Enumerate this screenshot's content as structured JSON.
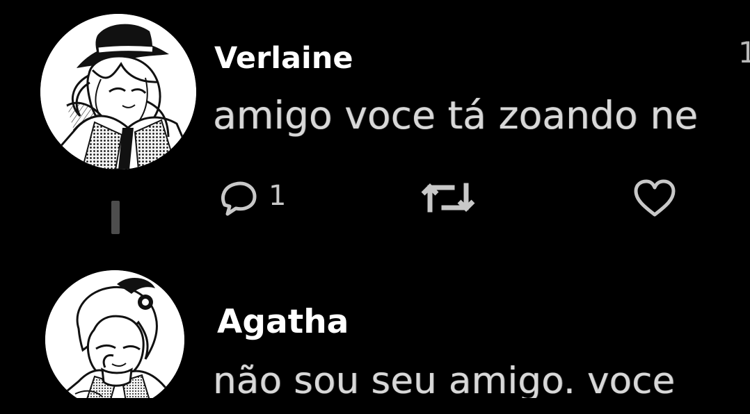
{
  "window": {
    "background_color": "#000000"
  },
  "posts": [
    {
      "author": "Verlaine",
      "message": "amigo voce tá zoando ne",
      "avatar_icon": "verlaine-avatar-icon"
    },
    {
      "author": "Agatha",
      "message": "não sou seu amigo. voce",
      "avatar_icon": "agatha-avatar-icon"
    }
  ],
  "actions": {
    "reply": {
      "icon": "reply-icon",
      "count": "1"
    },
    "retweet": {
      "icon": "retweet-icon"
    },
    "like": {
      "icon": "heart-icon"
    }
  },
  "truncated_text": "1",
  "colors": {
    "author_text": "#ffffff",
    "message_text": "#d8d8d8",
    "action_icons": "#d3d3d3"
  }
}
